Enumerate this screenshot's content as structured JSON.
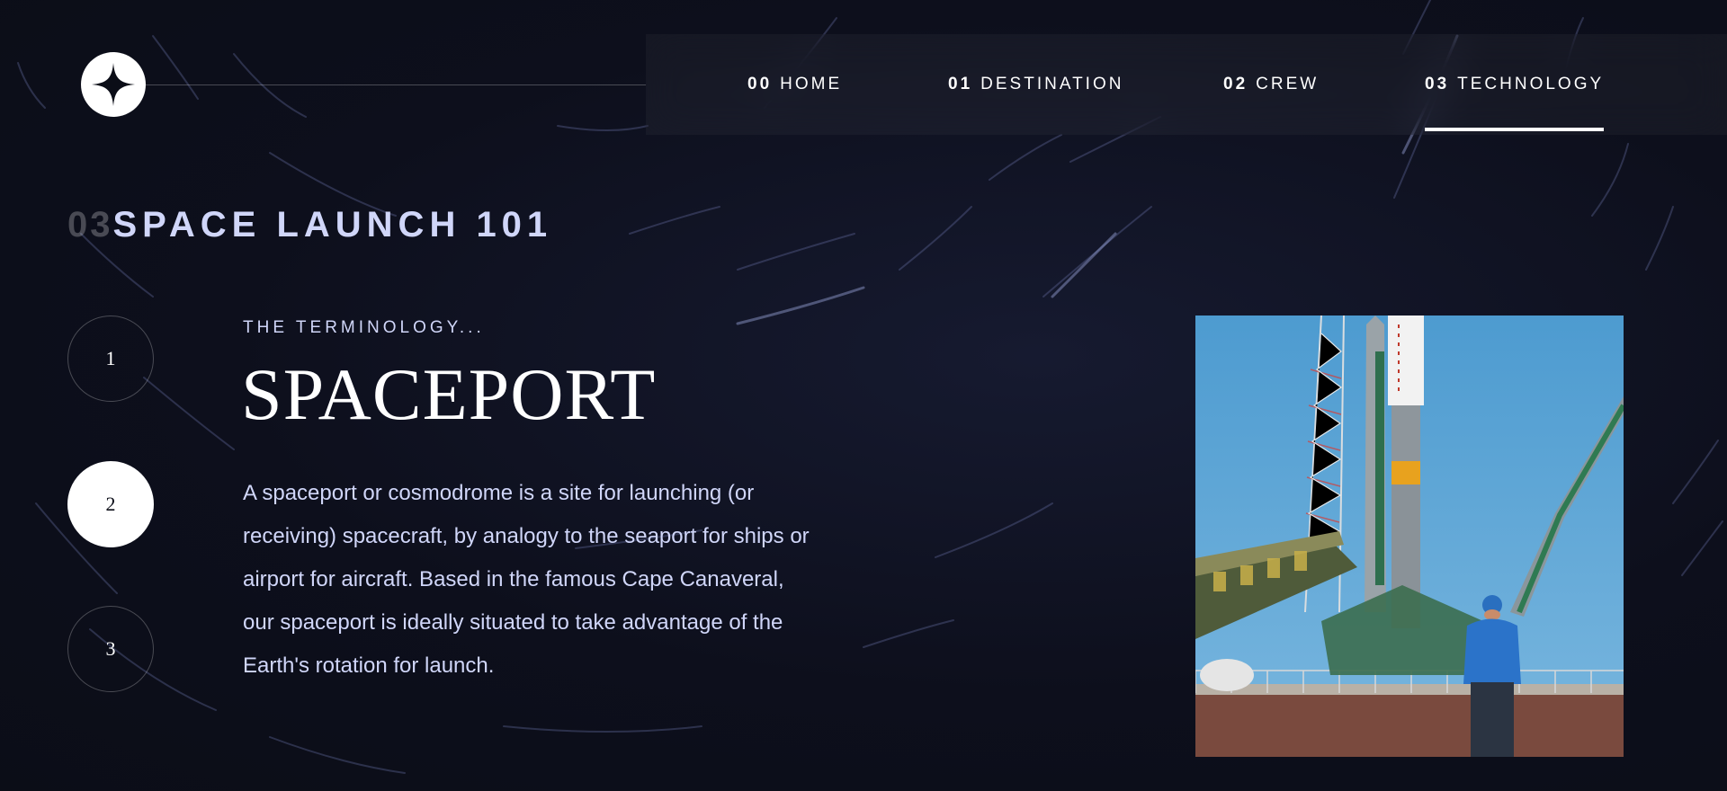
{
  "logo": {
    "icon": "star-icon"
  },
  "nav": {
    "items": [
      {
        "num": "00",
        "label": "HOME"
      },
      {
        "num": "01",
        "label": "DESTINATION"
      },
      {
        "num": "02",
        "label": "CREW"
      },
      {
        "num": "03",
        "label": "TECHNOLOGY"
      }
    ],
    "active": "TECHNOLOGY"
  },
  "heading": {
    "num": "03",
    "text": "SPACE LAUNCH 101"
  },
  "stepper": {
    "steps": [
      "1",
      "2",
      "3"
    ],
    "active": "2"
  },
  "content": {
    "eyebrow": "THE TERMINOLOGY...",
    "title": "SPACEPORT",
    "description": "A spaceport or cosmodrome is a site for launching (or receiving) spacecraft, by analogy to the seaport for ships or airport for aircraft. Based in the famous Cape Canaveral, our spaceport is ideally situated to take advantage of the Earth's rotation for launch."
  },
  "image": {
    "subject": "rocket-launch-pad-photo"
  },
  "colors": {
    "background": "#0b0d17",
    "text_secondary": "#d0d6f9",
    "white": "#ffffff"
  }
}
